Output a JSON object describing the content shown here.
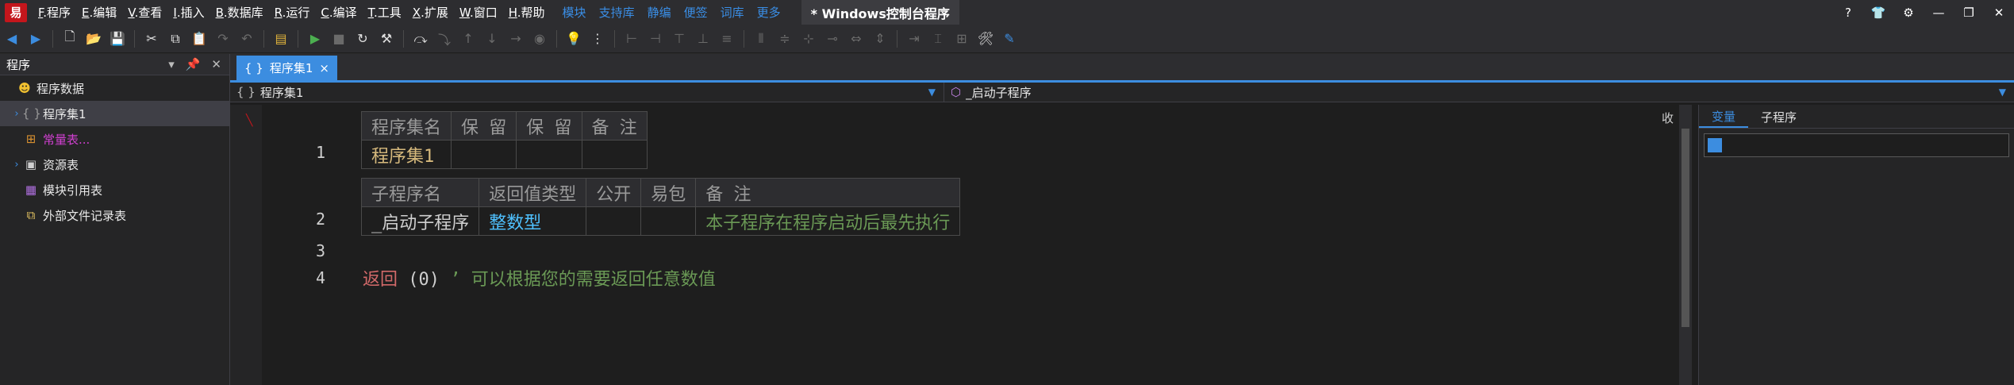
{
  "menubar": {
    "logo": "易",
    "menus": [
      {
        "key": "F",
        "label": ".程序"
      },
      {
        "key": "E",
        "label": ".编辑"
      },
      {
        "key": "V",
        "label": ".查看"
      },
      {
        "key": "I",
        "label": ".插入"
      },
      {
        "key": "B",
        "label": ".数据库"
      },
      {
        "key": "R",
        "label": ".运行"
      },
      {
        "key": "C",
        "label": ".编译"
      },
      {
        "key": "T",
        "label": ".工具"
      },
      {
        "key": "X",
        "label": ".扩展"
      },
      {
        "key": "W",
        "label": ".窗口"
      },
      {
        "key": "H",
        "label": ".帮助"
      }
    ],
    "links": [
      "模块",
      "支持库",
      "静编",
      "便签",
      "词库",
      "更多"
    ],
    "window_title": "* Windows控制台程序",
    "window_buttons": [
      "?",
      "👕",
      "⚙",
      "—",
      "❐",
      "✕"
    ]
  },
  "left_panel": {
    "title": "程序",
    "controls": [
      "▾",
      "📌",
      "✕"
    ],
    "items": [
      {
        "label": "程序数据",
        "icon": "☻",
        "icon_color": "#f0c030",
        "indent": 0,
        "expander": ""
      },
      {
        "label": "程序集1",
        "icon": "{ }",
        "icon_color": "#9a9a9a",
        "indent": 1,
        "expander": "›",
        "selected": true
      },
      {
        "label": "常量表...",
        "icon": "⊞",
        "icon_color": "#d89030",
        "indent": 1,
        "expander": "",
        "color": "#d040d0"
      },
      {
        "label": "资源表",
        "icon": "▣",
        "icon_color": "#cfcfcf",
        "indent": 1,
        "expander": "›"
      },
      {
        "label": "模块引用表",
        "icon": "▦",
        "icon_color": "#b070e0",
        "indent": 1,
        "expander": ""
      },
      {
        "label": "外部文件记录表",
        "icon": "⧉",
        "icon_color": "#e0c060",
        "indent": 1,
        "expander": ""
      }
    ]
  },
  "document": {
    "tab_label": "程序集1",
    "tab_icon": "{ }",
    "tab_close": "×",
    "nav_left": "程序集1",
    "nav_left_icon": "{ }",
    "nav_right": "_启动子程序",
    "nav_right_icon": "⬡",
    "collapse_label": "收"
  },
  "code": {
    "line_numbers": [
      "1",
      "2",
      "3",
      "4"
    ],
    "assembly_table": {
      "headers": [
        "程序集名",
        "保 留",
        "保 留",
        "备 注"
      ],
      "row": [
        "程序集1",
        "",
        "",
        ""
      ]
    },
    "sub_table": {
      "headers": [
        "子程序名",
        "返回值类型",
        "公开",
        "易包",
        "备 注"
      ],
      "row": [
        "_启动子程序",
        "整数型",
        "",
        "",
        "本子程序在程序启动后最先执行"
      ]
    },
    "line4": {
      "keyword": "返回",
      "args": "(0)",
      "comment": "’ 可以根据您的需要返回任意数值"
    }
  },
  "right_panel": {
    "tabs": [
      "变量",
      "子程序"
    ],
    "active_tab": 0
  }
}
